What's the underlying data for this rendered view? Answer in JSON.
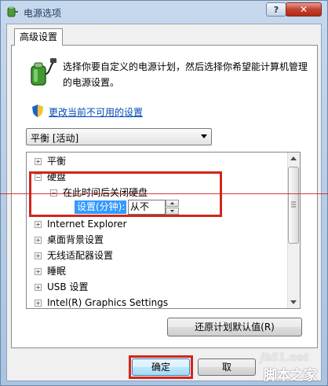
{
  "window": {
    "title": "电源选项",
    "help_label": "?",
    "close_label": "✕"
  },
  "tab": {
    "label": "高级设置"
  },
  "description": "选择你要自定义的电源计划，然后选择你希望能计算机管理的电源设置。",
  "link": {
    "label": "更改当前不可用的设置"
  },
  "plan_select": {
    "value": "平衡 [活动]"
  },
  "tree": {
    "items": [
      {
        "label": "平衡",
        "expander": "+"
      },
      {
        "label": "硬盘",
        "expander": "−"
      },
      {
        "label": "在此时间后关闭硬盘",
        "expander": "−"
      },
      {
        "label": "Internet Explorer",
        "expander": "+"
      },
      {
        "label": "桌面背景设置",
        "expander": "+"
      },
      {
        "label": "无线适配器设置",
        "expander": "+"
      },
      {
        "label": "睡眠",
        "expander": "+"
      },
      {
        "label": "USB 设置",
        "expander": "+"
      },
      {
        "label": "Intel(R) Graphics Settings",
        "expander": "+"
      }
    ],
    "setting_label": "设置(分钟):",
    "setting_value": "从不"
  },
  "buttons": {
    "restore": "还原计划默认值(R)",
    "ok": "确定",
    "cancel": "取"
  },
  "watermark": {
    "site": "jb51.net",
    "name": "脚本之家"
  },
  "colors": {
    "highlight": "#3399ff",
    "annotation_red": "#d0261d",
    "link": "#0049b7"
  }
}
